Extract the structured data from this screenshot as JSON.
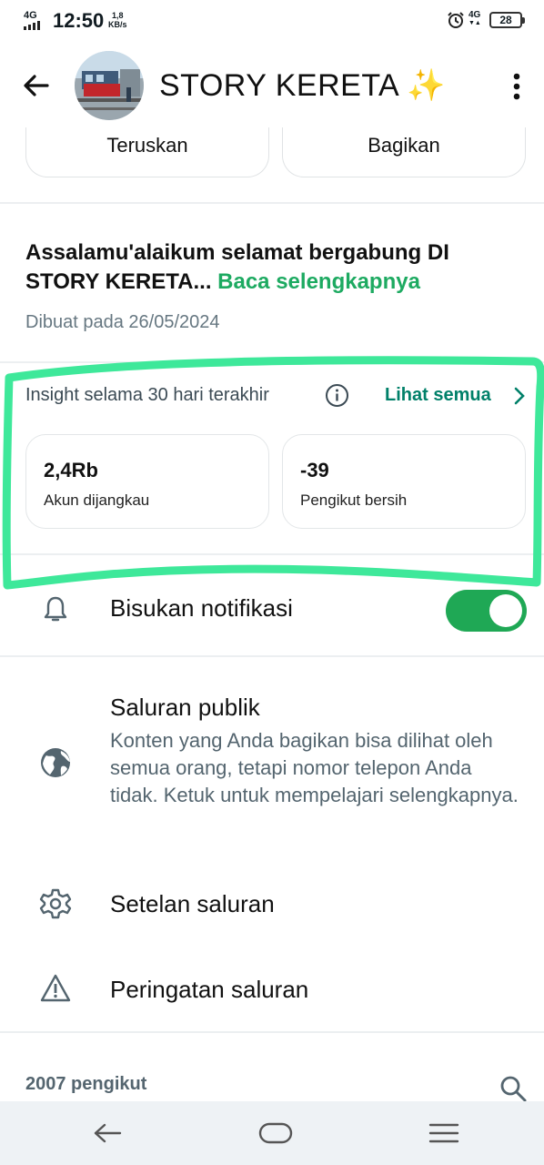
{
  "status_bar": {
    "network": "4G",
    "time": "12:50",
    "speed_value": "1,8",
    "speed_unit": "KB/s",
    "network_right": "4G",
    "battery": "28"
  },
  "header": {
    "channel_name": "STORY KERETA",
    "channel_emoji": "✨"
  },
  "actions": {
    "forward_label": "Teruskan",
    "share_label": "Bagikan"
  },
  "description": {
    "text": "Assalamu'alaikum selamat bergabung DI STORY KERETA...",
    "read_more": "Baca selengkapnya",
    "created": "Dibuat pada 26/05/2024"
  },
  "insight": {
    "heading": "Insight selama 30 hari terakhir",
    "see_all": "Lihat semua",
    "reach_value": "2,4Rb",
    "reach_label": "Akun dijangkau",
    "net_followers_value": "-39",
    "net_followers_label": "Pengikut bersih"
  },
  "settings": {
    "mute_label": "Bisukan notifikasi",
    "mute_on": true,
    "public_title": "Saluran publik",
    "public_desc": "Konten yang Anda bagikan bisa dilihat oleh semua orang, tetapi nomor telepon Anda tidak. Ketuk untuk mempelajari selengkapnya.",
    "channel_settings": "Setelan saluran",
    "channel_warning": "Peringatan saluran"
  },
  "followers": {
    "count_label": "2007 pengikut"
  },
  "colors": {
    "accent_green": "#1daa61",
    "link_green": "#008069",
    "toggle_green": "#1fa855",
    "highlight": "#3ee89a"
  }
}
